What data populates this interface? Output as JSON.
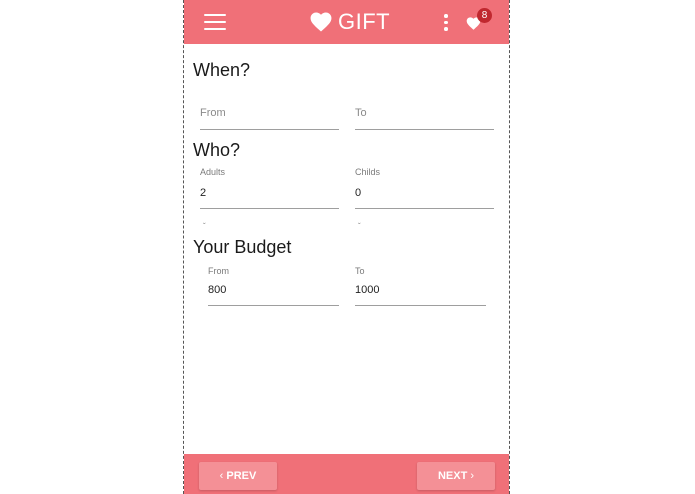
{
  "app": {
    "title": "GIFT",
    "favorites_count": "8",
    "accent_color": "#f07078",
    "badge_color": "#c0282f"
  },
  "icons": {
    "menu": "hamburger-menu-icon",
    "brand": "heart-icon",
    "more": "more-vertical-icon",
    "favorites": "heart-icon"
  },
  "when": {
    "title": "When?",
    "from_placeholder": "From",
    "to_placeholder": "To"
  },
  "who": {
    "title": "Who?",
    "adults_label": "Adults",
    "adults_value": "2",
    "childs_label": "Childs",
    "childs_value": "0"
  },
  "budget": {
    "title": "Your Budget",
    "from_label": "From",
    "from_value": "800",
    "to_label": "To",
    "to_value": "1000"
  },
  "footer": {
    "prev_label": "PREV",
    "next_label": "NEXT",
    "prev_chevron": "‹",
    "next_chevron": "›"
  }
}
